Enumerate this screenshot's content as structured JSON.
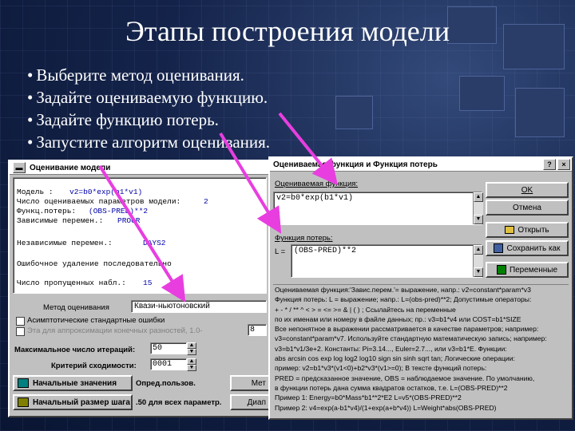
{
  "slide": {
    "title": "Этапы построения модели",
    "bullets": [
      "Выберите метод оценивания.",
      "Задайте оцениваемую функцию.",
      "Задайте функцию потерь.",
      "Запустите алгоритм оценивания."
    ]
  },
  "estimation_window": {
    "title": "Оценивание модели",
    "info_lines": [
      {
        "label": "Модель :",
        "value": "v2=b0*exp(b1*v1)"
      },
      {
        "label": "Число оцениваемых параметров модели:",
        "value": "2"
      },
      {
        "label": "Функц.потерь:",
        "value": "(OBS-PRED)**2"
      },
      {
        "label": "Зависимые перемен.:",
        "value": "PROGR"
      },
      {
        "label": "Независимые перемен.:",
        "value": "DAYS2"
      },
      {
        "label": "Ошибочное удаление последовательно",
        "value": ""
      },
      {
        "label": "Число пропущенных набл.:",
        "value": "15"
      }
    ],
    "method_label": "Метод оценивания",
    "method_value": "Квази-ньютоновский",
    "checkbox1_label": "Асимптотические стандартные ошибки",
    "checkbox2_label": "Эта для аппроксимации конечных разностей, 1.0-",
    "checkbox2_value": "8",
    "max_iter_label": "Максимальное число итераций:",
    "max_iter_value": "50",
    "conv_label": "Критерий сходимости:",
    "conv_value": "0001",
    "start_values_button": "Начальные значения",
    "start_values_note": "Опред.пользов.",
    "step_size_button": "Начальный размер шага",
    "step_size_note": ".50 для всех параметр.",
    "right_button_1": "Мет",
    "right_button_2": "Диап"
  },
  "function_window": {
    "title": "Оцениваемая функция и Функция потерь",
    "est_func_label": "Оцениваемая функция:",
    "est_func_value": "v2=b0*exp(b1*v1)",
    "loss_func_label": "Функция потерь:",
    "loss_func_prefix": "L =",
    "loss_func_value": "(OBS-PRED)**2",
    "buttons": {
      "ok": "OK",
      "cancel": "Отмена",
      "open": "Открыть",
      "save_as": "Сохранить как",
      "variables": "Переменные"
    },
    "help_lines": [
      "Оцениваемая функция:'Завис.перем.'= выражение, напр.: v2=constant*param*v3",
      "Функция потерь: L = выражение; напр.: L=(obs-pred)**2; Допустимые операторы:",
      "+ - * / ** ^ < > = <= >= & | ( ) ; Ссылайтесь на переменные",
      "по их именам или номеру в файле данных; пр.: v3=b1*v4  или  COST=b1*SIZE",
      "Все непонятное в выражении рассматривается в качестве параметров; например:",
      "v3=constant*param*v7. Используйте стандартную математическую запись; например:",
      "v3=b1*v1/3e+2. Константы: Pi=3.14..., Euler=2.7..., или  v3=b1*E. Функции:",
      "abs arcsin cos exp log log2 log10 sign sin sinh sqrt tan; Логические операции:",
      "пример: v2=b1*v3*(v1<0)+b2*v3*(v1>=0); В тексте функций потерь:",
      "PRED = предсказанное значение, OBS = наблюдаемое значение. По умолчанию,",
      "в функции потерь дана сумма квадратов остатков, т.е. L=(OBS-PRED)**2",
      "Пример 1: Energy=b0*Mass*b1**2*E2    L=v5*(OBS-PRED)**2",
      "Пример 2: v4=exp(a-b1*v4)/(1+exp(a+b*v4))    L=Weight*abs(OBS-PRED)"
    ]
  },
  "icons": [
    "window-menu-icon",
    "help-icon",
    "close-icon",
    "open-folder-icon",
    "save-disk-icon",
    "variables-icon",
    "start-values-icon",
    "step-size-icon"
  ],
  "colors": {
    "slide_bg": "#0b1736",
    "arrow": "#e83ee0",
    "window": "#c0c0c0",
    "blue_text": "#0000a8"
  }
}
